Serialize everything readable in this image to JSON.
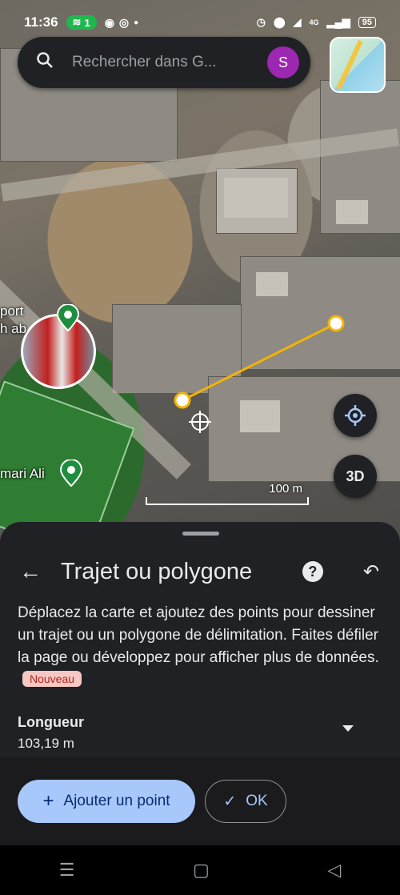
{
  "status_bar": {
    "time": "11:36",
    "wifi_count": "1",
    "signal": "4G",
    "battery": "95"
  },
  "search": {
    "placeholder": "Rechercher dans G...",
    "avatar_letter": "S"
  },
  "map": {
    "label_sport": "port\nh ab",
    "label_place": "mari Ali",
    "scale_label": "100 m",
    "btn_3d": "3D"
  },
  "sheet": {
    "title": "Trajet ou polygone",
    "description": "Déplacez la carte et ajoutez des points pour dessiner un trajet ou un polygone de délimitation. Faites défiler la page ou développez pour afficher plus de données.",
    "badge": "Nouveau",
    "metric_label": "Longueur",
    "metric_value": "103,19 m",
    "add_point_label": "Ajouter un point",
    "ok_label": "OK"
  },
  "colors": {
    "route_line": "#f4b400",
    "primary_button": "#a8c7fa",
    "pin_green": "#1e8e3e"
  }
}
